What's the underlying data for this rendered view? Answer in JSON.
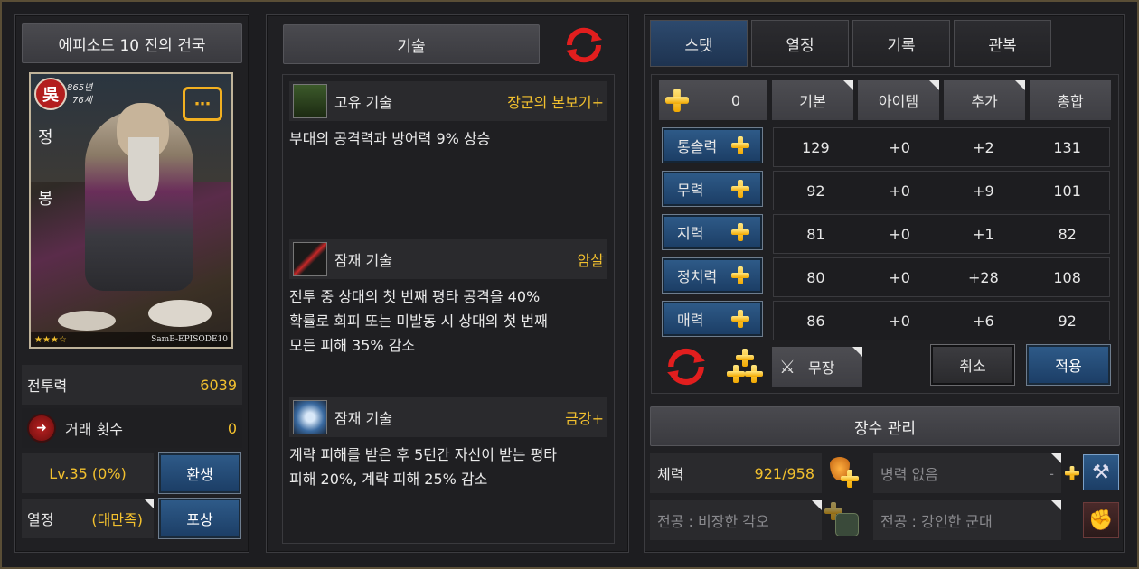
{
  "left": {
    "episode_button": "에피소드 10 진의 건국",
    "card": {
      "faction": "吳",
      "birth": "865년",
      "age": "76세",
      "name_chars": [
        "정",
        "봉"
      ],
      "stars": "★★★☆",
      "footer": "SamB-EPISODE10"
    },
    "power_label": "전투력",
    "power_value": "6039",
    "trade_label": "거래 횟수",
    "trade_value": "0",
    "level": "Lv.35 (0%)",
    "rebirth_button": "환생",
    "passion_label": "열정",
    "passion_value": "(대만족)",
    "reward_button": "포상"
  },
  "middle": {
    "title": "기술",
    "skills": [
      {
        "type": "고유 기술",
        "name": "장군의 본보기+",
        "desc": [
          "부대의 공격력과 방어력 9% 상승"
        ]
      },
      {
        "type": "잠재 기술",
        "name": "암살",
        "desc": [
          "전투 중 상대의 첫 번째 평타 공격을 40%",
          "확률로 회피 또는 미발동 시 상대의 첫 번째",
          "모든 피해 35% 감소"
        ]
      },
      {
        "type": "잠재 기술",
        "name": "금강+",
        "desc": [
          "계략 피해를 받은 후 5턴간 자신이 받는 평타",
          "피해 20%, 계략 피해 25% 감소"
        ]
      }
    ]
  },
  "right": {
    "tabs": [
      "스탯",
      "열정",
      "기록",
      "관복"
    ],
    "points": "0",
    "headers": [
      "기본",
      "아이템",
      "추가",
      "총합"
    ],
    "stats": [
      {
        "name": "통솔력",
        "base": "129",
        "item": "+0",
        "extra": "+2",
        "total": "131"
      },
      {
        "name": "무력",
        "base": "92",
        "item": "+0",
        "extra": "+9",
        "total": "101"
      },
      {
        "name": "지력",
        "base": "81",
        "item": "+0",
        "extra": "+1",
        "total": "82"
      },
      {
        "name": "정치력",
        "base": "80",
        "item": "+0",
        "extra": "+28",
        "total": "108"
      },
      {
        "name": "매력",
        "base": "86",
        "item": "+0",
        "extra": "+6",
        "total": "92"
      }
    ],
    "class_label": "무장",
    "cancel_button": "취소",
    "apply_button": "적용",
    "manage_button": "장수 관리",
    "hp_label": "체력",
    "hp_value": "921/958",
    "troops_label": "병력 없음",
    "troops_value": "-",
    "merit1": "전공 : 비장한 각오",
    "merit2": "전공 : 강인한 군대"
  },
  "colors": {
    "gold": "#f2c02e",
    "blue_button": "#2e5a88",
    "panel": "#202023"
  }
}
